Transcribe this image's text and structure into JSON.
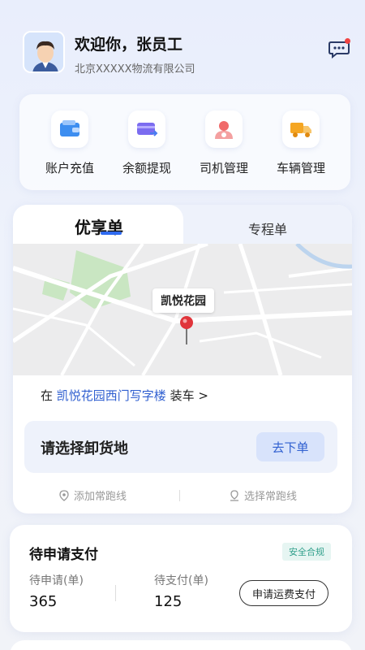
{
  "header": {
    "greeting": "欢迎你，张员工",
    "company": "北京XXXXX物流有限公司"
  },
  "quick_actions": [
    {
      "label": "账户充值",
      "icon": "wallet-icon"
    },
    {
      "label": "余额提现",
      "icon": "card-withdraw-icon"
    },
    {
      "label": "司机管理",
      "icon": "driver-icon"
    },
    {
      "label": "车辆管理",
      "icon": "truck-icon"
    }
  ],
  "order": {
    "tabs": [
      "优享单",
      "专程单"
    ],
    "active_tab": "优享单",
    "map_pin_label": "凯悦花园",
    "load_prefix": "在",
    "load_location": "凯悦花园西门写字楼",
    "load_suffix": "装车 >",
    "unload_prompt": "请选择卸货地",
    "order_button": "去下单",
    "add_route": "添加常跑线",
    "select_route": "选择常跑线"
  },
  "payment": {
    "title": "待申请支付",
    "badge": "安全合规",
    "pending_apply_label": "待申请(单)",
    "pending_apply_value": "365",
    "pending_pay_label": "待支付(单)",
    "pending_pay_value": "125",
    "apply_button": "申请运费支付"
  },
  "colors": {
    "accent": "#2f6bf0",
    "link": "#2f5fd0",
    "pin": "#e0353b",
    "badge_text": "#32a08c"
  }
}
